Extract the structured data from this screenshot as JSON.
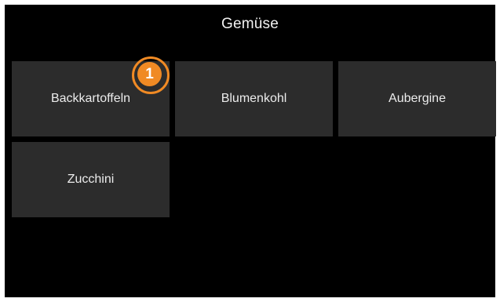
{
  "header": {
    "title": "Gemüse"
  },
  "tiles": [
    {
      "label": "Backkartoffeln"
    },
    {
      "label": "Blumenkohl"
    },
    {
      "label": "Aubergine"
    },
    {
      "label": "Zucchini"
    }
  ],
  "badge": {
    "number": "1"
  },
  "colors": {
    "background": "#000000",
    "tile": "#2c2c2c",
    "text": "#ececec",
    "accent": "#f08a24"
  }
}
